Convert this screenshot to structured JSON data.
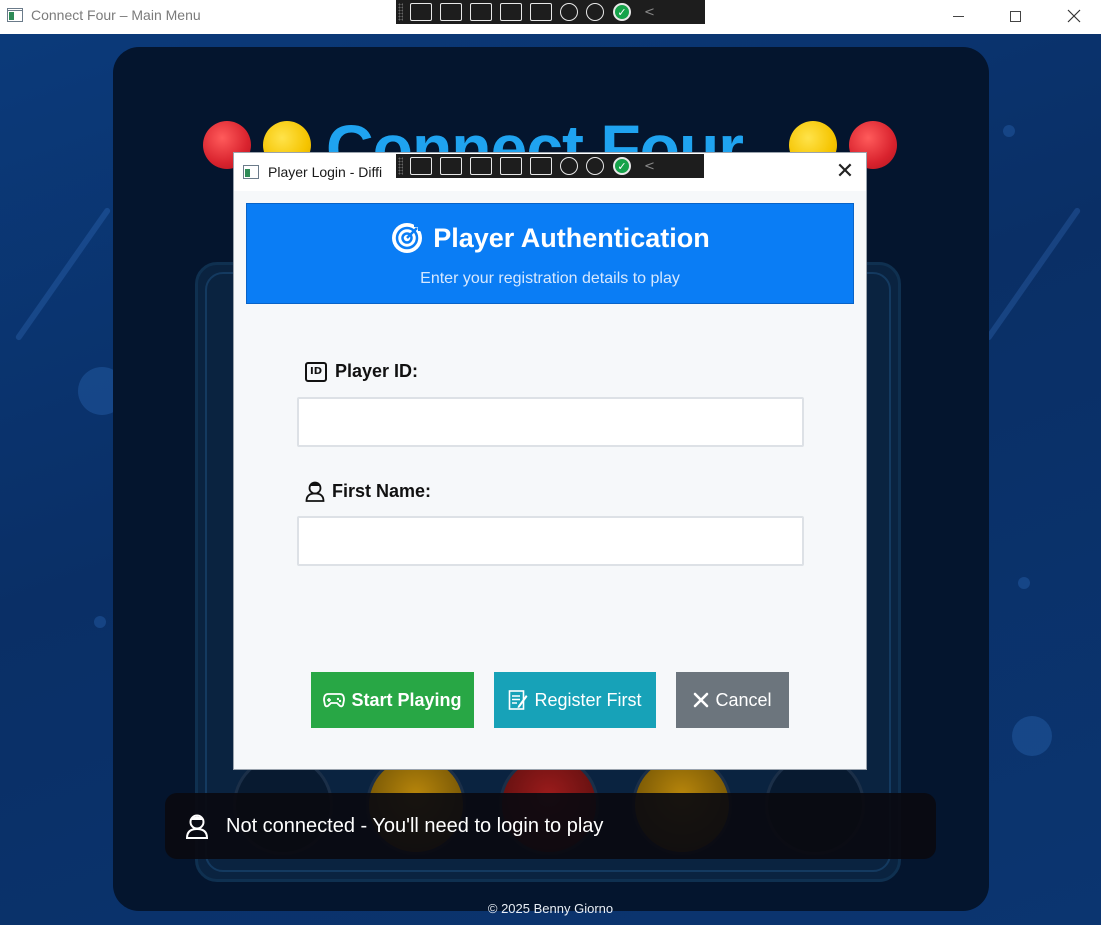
{
  "window": {
    "title": "Connect Four – Main Menu"
  },
  "background": {
    "game_title": "Connect Four",
    "status_text": "Not connected - You'll need to login to play",
    "copyright": "© 2025  Benny Giorno"
  },
  "dialog": {
    "title": "Player Login - Diffi",
    "close_glyph": "✕",
    "header": {
      "title": "Player Authentication",
      "subtitle": "Enter your registration details to play"
    },
    "fields": {
      "player_id": {
        "icon_text": "ID",
        "label": "Player ID:",
        "value": ""
      },
      "first_name": {
        "label": "First Name:",
        "value": ""
      }
    },
    "buttons": {
      "start": "Start Playing",
      "register": "Register First",
      "cancel": "Cancel"
    }
  },
  "colors": {
    "header_blue": "#0a7df5",
    "start_green": "#28a745",
    "register_teal": "#17a2b8",
    "cancel_gray": "#6c757d",
    "chip_red": "#d9232e",
    "chip_yellow": "#f5c400"
  },
  "icons": {
    "title_target": "target-icon",
    "player_id": "id-card-icon",
    "first_name": "person-icon",
    "start": "gamepad-icon",
    "register": "edit-form-icon",
    "cancel": "close-icon",
    "status": "person-icon"
  }
}
